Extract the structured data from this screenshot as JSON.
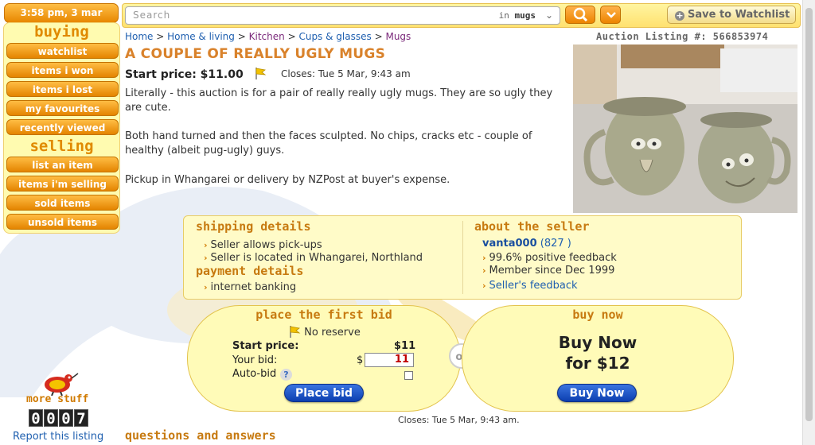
{
  "clock": "3:58 pm, 3 mar",
  "sidebar": {
    "buying_title": "buying",
    "buying_items": [
      "watchlist",
      "items i won",
      "items i lost",
      "my favourites",
      "recently viewed"
    ],
    "selling_title": "selling",
    "selling_items": [
      "list an item",
      "items i'm selling",
      "sold items",
      "unsold items"
    ]
  },
  "search": {
    "placeholder": "Search",
    "in_label": "in",
    "in_value": "mugs"
  },
  "watchlist_button": "Save to Watchlist",
  "breadcrumb": {
    "items": [
      "Home",
      "Home & living",
      "Kitchen",
      "Cups & glasses",
      "Mugs"
    ],
    "separator": ">"
  },
  "listing_number": "Auction Listing #: 566853974",
  "listing": {
    "title": "A COUPLE OF REALLY UGLY MUGS",
    "start_price": "Start price: $11.00",
    "closes": "Closes: Tue 5 Mar, 9:43 am",
    "description": [
      "Literally - this auction is for a pair of really really ugly mugs. They are so ugly they are cute.",
      "Both hand turned and then the faces sculpted. No chips, cracks etc - couple of healthy (albeit pug-ugly) guys.",
      "Pickup in Whangarei or delivery by NZPost at buyer's expense."
    ]
  },
  "shipping": {
    "title": "shipping details",
    "items": [
      "Seller allows pick-ups",
      "Seller is located in Whangarei, Northland"
    ]
  },
  "payment": {
    "title": "payment details",
    "items": [
      "internet banking"
    ]
  },
  "seller": {
    "title": "about the seller",
    "name": "vanta000",
    "rating": "(827 )",
    "items": [
      "99.6% positive feedback",
      "Member since Dec 1999"
    ],
    "feedback_link": "Seller's feedback"
  },
  "bid": {
    "title": "place the first bid",
    "reserve": "No reserve",
    "start_label": "Start price:",
    "start_value": "$11",
    "your_bid_label": "Your bid:",
    "currency": "$",
    "your_bid_value": "11",
    "autobid_label": "Auto-bid",
    "button": "Place bid"
  },
  "or_label": "or",
  "buy_now": {
    "title": "buy now",
    "line1": "Buy Now",
    "line2": "for $12",
    "button": "Buy Now"
  },
  "closes_footer": "Closes: Tue 5 Mar, 9:43 am.",
  "questions_title": "questions and answers",
  "more_stuff": "more stuff",
  "counter": [
    "0",
    "0",
    "0",
    "7"
  ],
  "report_link": "Report this listing",
  "colors": {
    "accent_orange": "#e88700",
    "title_orange": "#d9822b",
    "panel_yellow": "#fffbb8",
    "link_blue": "#2060b0",
    "button_blue": "#0c3fb0"
  }
}
